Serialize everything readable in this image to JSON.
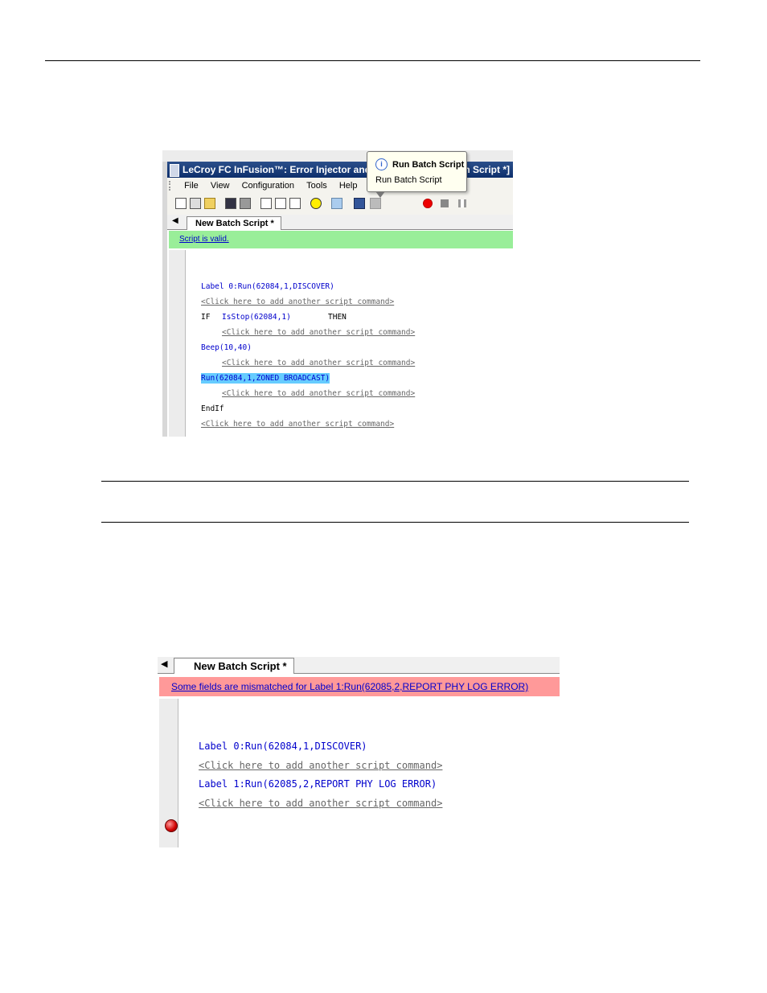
{
  "colors": {
    "valid_banner": "#99ee99",
    "error_banner": "#ff9999",
    "highlight": "#66ccff",
    "code_blue": "#0000cc"
  },
  "screenshot1": {
    "title_left": "LeCroy FC InFusion™: Error Injector and Tra",
    "title_right": "h Script *]",
    "menu": [
      "File",
      "View",
      "Configuration",
      "Tools",
      "Help"
    ],
    "tab_label": "New Batch Script *",
    "status": "Script is valid.",
    "tooltip": {
      "title": "Run Batch Script",
      "body": "Run Batch Script"
    },
    "lines": [
      "Label 0:Run(62084,1,DISCOVER)",
      "<Click here to add another script command>",
      "IF",
      "IsStop(62084,1)",
      "THEN",
      "<Click here to add another script command>",
      "Beep(10,40)",
      "<Click here to add another script command>",
      "Run(62084,1,ZONED BROADCAST)",
      "<Click here to add another script command>",
      "EndIf",
      "<Click here to add another script command>"
    ]
  },
  "screenshot2": {
    "tab_label": "New Batch Script *",
    "status": "Some fields are mismatched for  Label 1:Run(62085,2,REPORT PHY LOG ERROR)",
    "lines": [
      "Label 0:Run(62084,1,DISCOVER)",
      "<Click here to add another script command>",
      "Label 1:Run(62085,2,REPORT PHY LOG ERROR)",
      "<Click here to add another script command>"
    ]
  }
}
